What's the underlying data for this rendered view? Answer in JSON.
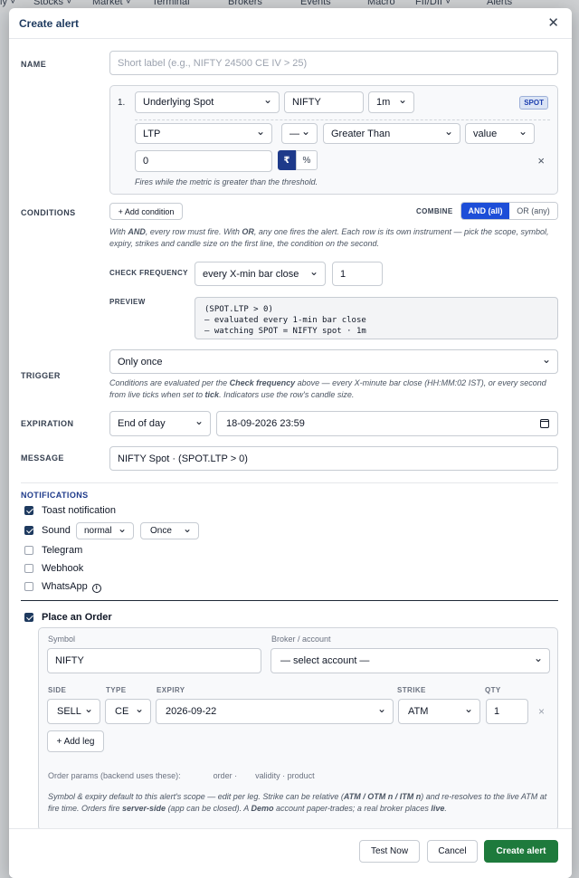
{
  "background": {
    "nav": [
      "ly ˅",
      "Stocks ˅",
      "Market ˅",
      "Terminal",
      "Brokers",
      "Events",
      "Macro",
      "FII/DII ˅",
      "Alerts"
    ]
  },
  "modal": {
    "title": "Create alert",
    "close_icon": "close-icon"
  },
  "name": {
    "label": "NAME",
    "placeholder": "Short label (e.g., NIFTY 24500 CE IV > 25)",
    "value": ""
  },
  "conditions": {
    "label": "CONDITIONS",
    "row": {
      "index": "1.",
      "source": "Underlying Spot",
      "symbol": "NIFTY",
      "interval": "1m",
      "badge": "SPOT",
      "metric": "LTP",
      "modifier": "—",
      "operator": "Greater Than",
      "compare_to": "value",
      "threshold": "0",
      "unit_rupee": "₹",
      "unit_percent": "%",
      "remove": "×",
      "hint": "Fires while the metric is greater than the threshold."
    },
    "add_button": "+ Add condition",
    "combine_label": "COMBINE",
    "combine_and": "AND (all)",
    "combine_or": "OR (any)",
    "help_1": "With ",
    "help_and": "AND",
    "help_2": ", every row must fire. With ",
    "help_or": "OR",
    "help_3": ", any one fires the alert. Each row is its own instrument — pick the scope, symbol, expiry, strikes and candle size on the first line, the condition on the second.",
    "check_frequency_label": "CHECK FREQUENCY",
    "check_frequency": "every X-min bar close",
    "check_frequency_n": "1",
    "preview_label": "PREVIEW",
    "preview_lines": [
      "(SPOT.LTP > 0)",
      "— evaluated every 1-min bar close",
      "— watching SPOT = NIFTY spot · 1m"
    ]
  },
  "trigger": {
    "label": "TRIGGER",
    "value": "Only once",
    "help_1": "Conditions are evaluated per the ",
    "help_bold": "Check frequency",
    "help_2": " above — every X-minute bar close (HH:MM:02 IST), or every second from live ticks when set to ",
    "help_tick": "tick",
    "help_3": ". Indicators use the row's candle size."
  },
  "expiration": {
    "label": "EXPIRATION",
    "mode": "End of day",
    "datetime": "18-09-2026  23:59"
  },
  "message": {
    "label": "MESSAGE",
    "value": "NIFTY Spot · (SPOT.LTP > 0)"
  },
  "notifications": {
    "label": "NOTIFICATIONS",
    "toast": {
      "label": "Toast notification",
      "checked": true
    },
    "sound": {
      "label": "Sound",
      "checked": true,
      "tone": "normal",
      "repeat": "Once"
    },
    "telegram": {
      "label": "Telegram",
      "checked": false
    },
    "webhook": {
      "label": "Webhook",
      "checked": false
    },
    "whatsapp": {
      "label": "WhatsApp",
      "checked": false
    }
  },
  "order": {
    "label": "Place an Order",
    "checked": true,
    "symbol_label": "Symbol",
    "symbol": "NIFTY",
    "broker_label": "Broker / account",
    "broker": "— select account —",
    "side_label": "SIDE",
    "type_label": "TYPE",
    "expiry_label": "EXPIRY",
    "strike_label": "STRIKE",
    "qty_label": "QTY",
    "side": "SELL",
    "type": "CE",
    "expiry": "2026-09-22",
    "strike": "ATM",
    "qty": "1",
    "remove": "×",
    "add_leg": "+ Add leg",
    "params_1": "Order params (backend uses these):",
    "params_2": "order ·",
    "params_3": "validity · product",
    "note_1": "Symbol & expiry default to this alert's scope — edit per leg. Strike can be relative (",
    "note_bold1": "ATM / OTM n / ITM n",
    "note_2": ") and re-resolves to the live ATM at fire time. Orders fire ",
    "note_bold2": "server-side",
    "note_3": " (app can be closed). A ",
    "note_bold3": "Demo",
    "note_4": " account paper-trades; a real broker places ",
    "note_bold4": "live",
    "note_5": "."
  },
  "footer": {
    "test": "Test Now",
    "cancel": "Cancel",
    "create": "Create alert"
  }
}
